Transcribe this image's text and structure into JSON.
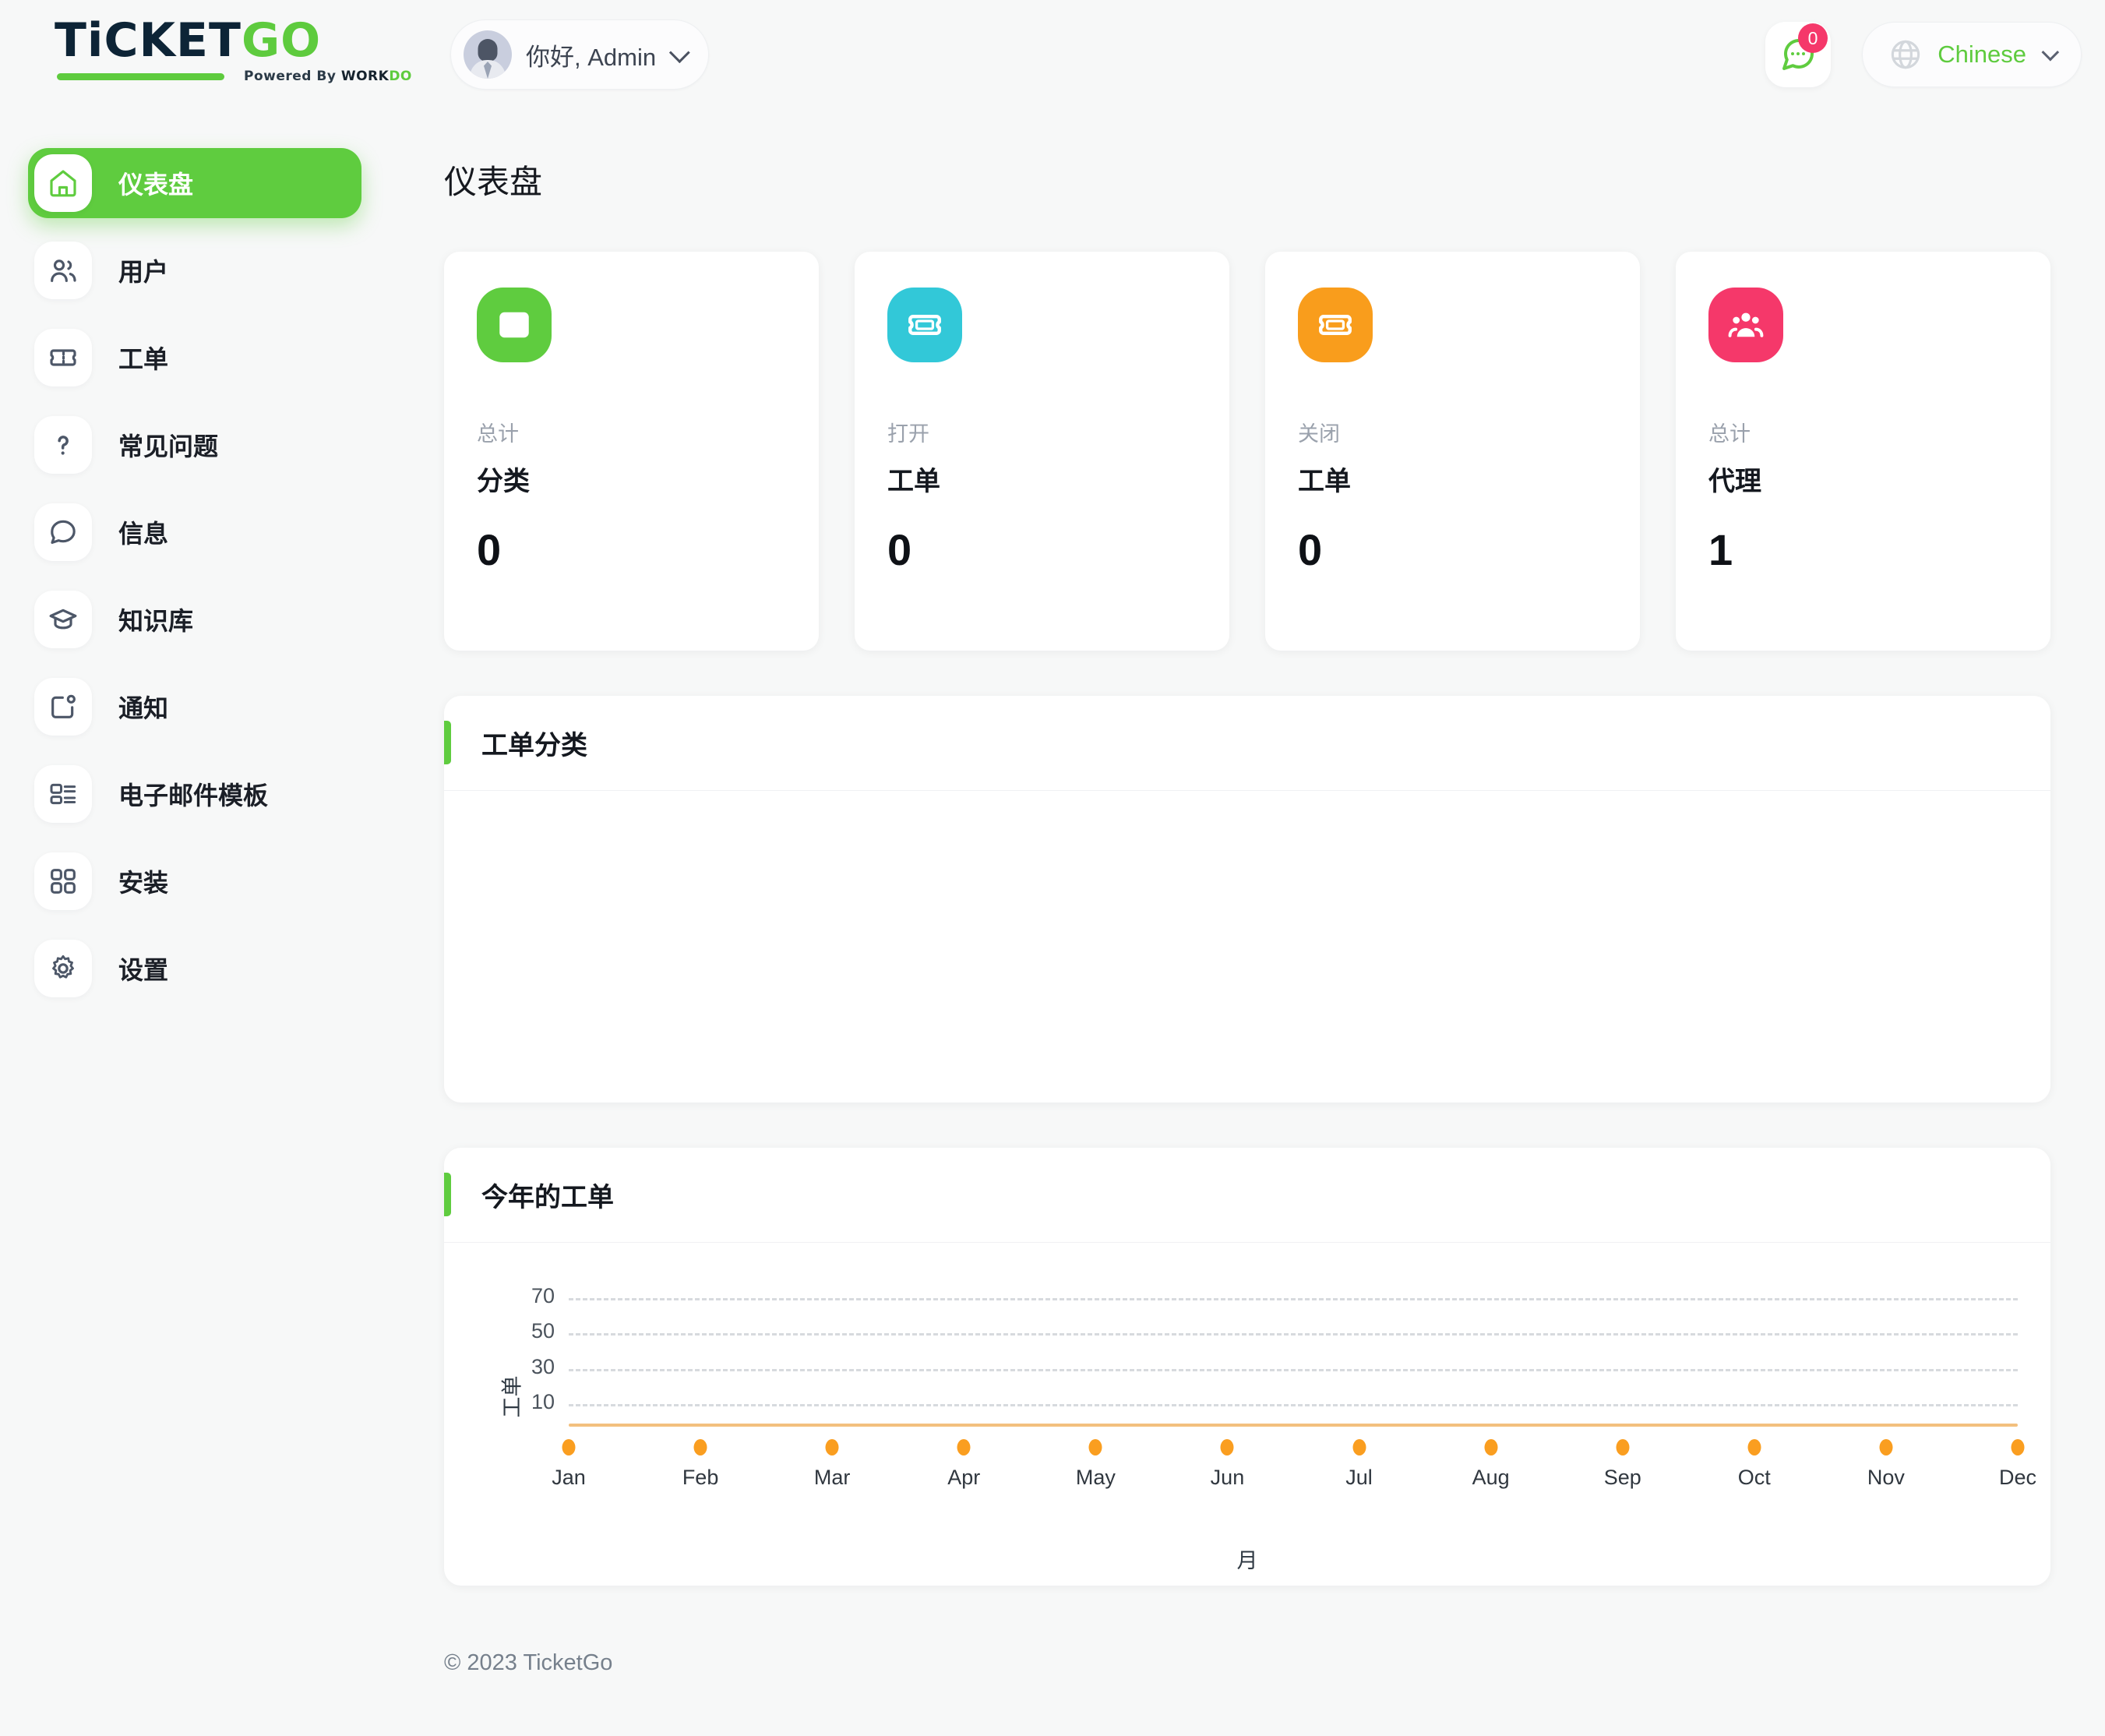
{
  "brand": {
    "logo_main": "TiCKET",
    "logo_accent": "GO",
    "powered_prefix": "Powered By ",
    "powered_brand": "WORK",
    "powered_brand_accent": "DO"
  },
  "topbar": {
    "greeting": "你好, Admin",
    "avatar_name": "admin-avatar",
    "message_badge": "0",
    "language": "Chinese"
  },
  "sidebar": {
    "items": [
      {
        "label": "仪表盘",
        "icon": "home-icon",
        "active": true
      },
      {
        "label": "用户",
        "icon": "users-icon",
        "active": false
      },
      {
        "label": "工单",
        "icon": "ticket-icon",
        "active": false
      },
      {
        "label": "常见问题",
        "icon": "question-icon",
        "active": false
      },
      {
        "label": "信息",
        "icon": "chat-icon",
        "active": false
      },
      {
        "label": "知识库",
        "icon": "graduation-cap-icon",
        "active": false
      },
      {
        "label": "通知",
        "icon": "bell-notification-icon",
        "active": false
      },
      {
        "label": "电子邮件模板",
        "icon": "email-template-icon",
        "active": false
      },
      {
        "label": "安装",
        "icon": "grid-apps-icon",
        "active": false
      },
      {
        "label": "设置",
        "icon": "gear-icon",
        "active": false
      }
    ]
  },
  "page": {
    "title": "仪表盘"
  },
  "stats": [
    {
      "sub": "总计",
      "name": "分类",
      "value": "0",
      "color": "#5fcc3f",
      "icon": "list-box-icon"
    },
    {
      "sub": "打开",
      "name": "工单",
      "value": "0",
      "color": "#32c8d8",
      "icon": "ticket-icon"
    },
    {
      "sub": "关闭",
      "name": "工单",
      "value": "0",
      "color": "#f99d1c",
      "icon": "ticket-icon"
    },
    {
      "sub": "总计",
      "name": "代理",
      "value": "1",
      "color": "#f5386a",
      "icon": "people-group-icon"
    }
  ],
  "panels": {
    "categories_title": "工单分类",
    "yearly_title": "今年的工单"
  },
  "chart_data": {
    "type": "line",
    "title": "今年的工单",
    "xlabel": "月",
    "ylabel": "工单",
    "categories": [
      "Jan",
      "Feb",
      "Mar",
      "Apr",
      "May",
      "Jun",
      "Jul",
      "Aug",
      "Sep",
      "Oct",
      "Nov",
      "Dec"
    ],
    "series": [
      {
        "name": "工单",
        "values": [
          0,
          0,
          0,
          0,
          0,
          0,
          0,
          0,
          0,
          0,
          0,
          0
        ],
        "color": "#fa9e20"
      }
    ],
    "yticks": [
      70,
      50,
      30,
      10
    ],
    "ylim": [
      0,
      80
    ],
    "grid": true,
    "legend": "none",
    "line_color": "#f3c07e",
    "marker_color": "#fa9e20"
  },
  "footer": {
    "copyright": "© 2023 TicketGo"
  }
}
